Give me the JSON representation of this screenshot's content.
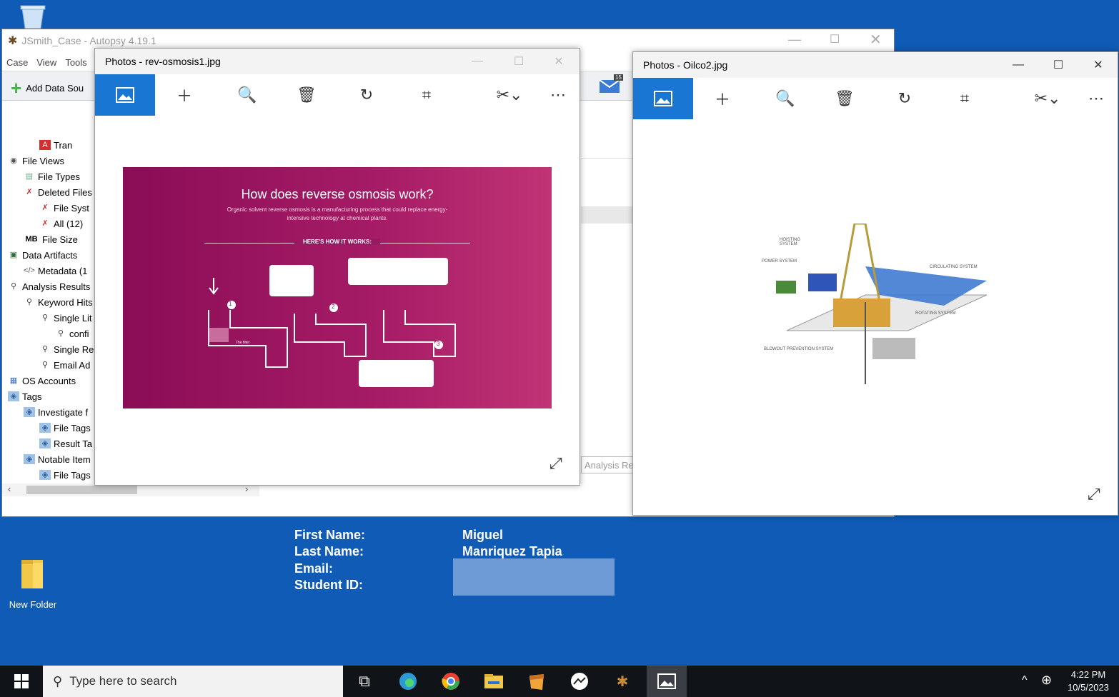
{
  "desktop": {
    "new_folder_label": "New Folder"
  },
  "autopsy": {
    "title": "JSmith_Case - Autopsy 4.19.1",
    "menu": [
      "Case",
      "View",
      "Tools"
    ],
    "add_data_source": "Add Data Sou",
    "mail_badge": "15",
    "tree": [
      {
        "label": "Tran",
        "indent": 2,
        "icon": "pdf-icon"
      },
      {
        "label": "File Views",
        "indent": 0,
        "icon": "eye-icon"
      },
      {
        "label": "File Types",
        "indent": 1,
        "icon": "filetypes-icon"
      },
      {
        "label": "Deleted Files",
        "indent": 1,
        "icon": "deleted-icon"
      },
      {
        "label": "File Syst",
        "indent": 2,
        "icon": "deleted-icon"
      },
      {
        "label": "All (12)",
        "indent": 2,
        "icon": "deleted-icon"
      },
      {
        "label": "File Size",
        "indent": 1,
        "icon": "mb-icon"
      },
      {
        "label": "Data Artifacts",
        "indent": 0,
        "icon": "artifact-icon"
      },
      {
        "label": "Metadata (1",
        "indent": 1,
        "icon": "code-icon"
      },
      {
        "label": "Analysis Results",
        "indent": 0,
        "icon": "search-icon"
      },
      {
        "label": "Keyword Hits",
        "indent": 1,
        "icon": "search-icon"
      },
      {
        "label": "Single Lit",
        "indent": 2,
        "icon": "search-icon"
      },
      {
        "label": "confi",
        "indent": 3,
        "icon": "search-icon"
      },
      {
        "label": "Single Re",
        "indent": 2,
        "icon": "search-icon"
      },
      {
        "label": "Email Ad",
        "indent": 2,
        "icon": "search-icon"
      },
      {
        "label": "OS Accounts",
        "indent": 0,
        "icon": "accounts-icon"
      },
      {
        "label": "Tags",
        "indent": 0,
        "icon": "tag-icon"
      },
      {
        "label": "Investigate f",
        "indent": 1,
        "icon": "tag-icon"
      },
      {
        "label": "File Tags",
        "indent": 2,
        "icon": "tag-icon"
      },
      {
        "label": "Result Ta",
        "indent": 2,
        "icon": "tag-icon"
      },
      {
        "label": "Notable Item",
        "indent": 1,
        "icon": "tag-icon"
      },
      {
        "label": "File Tags",
        "indent": 2,
        "icon": "tag-icon"
      }
    ],
    "analysis_tab_label": "Analysis Res"
  },
  "photo1": {
    "title": "Photos - rev-osmosis1.jpg",
    "image": {
      "heading": "How does reverse osmosis work?",
      "subheading": "Organic solvent reverse osmosis is a manufacturing process that could replace energy-intensive technology at chemical plants.",
      "section": "HERE'S HOW IT WORKS:",
      "step_numbers": [
        "1",
        "2",
        "3"
      ],
      "filter_label": "The filter"
    }
  },
  "photo2": {
    "title": "Photos - Oilco2.jpg",
    "image": {
      "labels": [
        "HOISTING SYSTEM",
        "POWER SYSTEM",
        "CIRCULATING SYSTEM",
        "ROTATING SYSTEM",
        "BLOWOUT PREVENTION SYSTEM"
      ]
    }
  },
  "student_info": {
    "first_name_label": "First Name:",
    "last_name_label": "Last Name:",
    "email_label": "Email:",
    "student_id_label": "Student ID:",
    "first_name": "Miguel",
    "last_name": "Manriquez Tapia"
  },
  "taskbar": {
    "search_placeholder": "Type here to search",
    "time": "4:22 PM",
    "date": "10/5/2023"
  },
  "colors": {
    "desktop_bg": "#0f5bb5",
    "photos_accent": "#1976d2",
    "osmosis_bg": "#9c1a64",
    "redaction": "#6e9bd6"
  }
}
